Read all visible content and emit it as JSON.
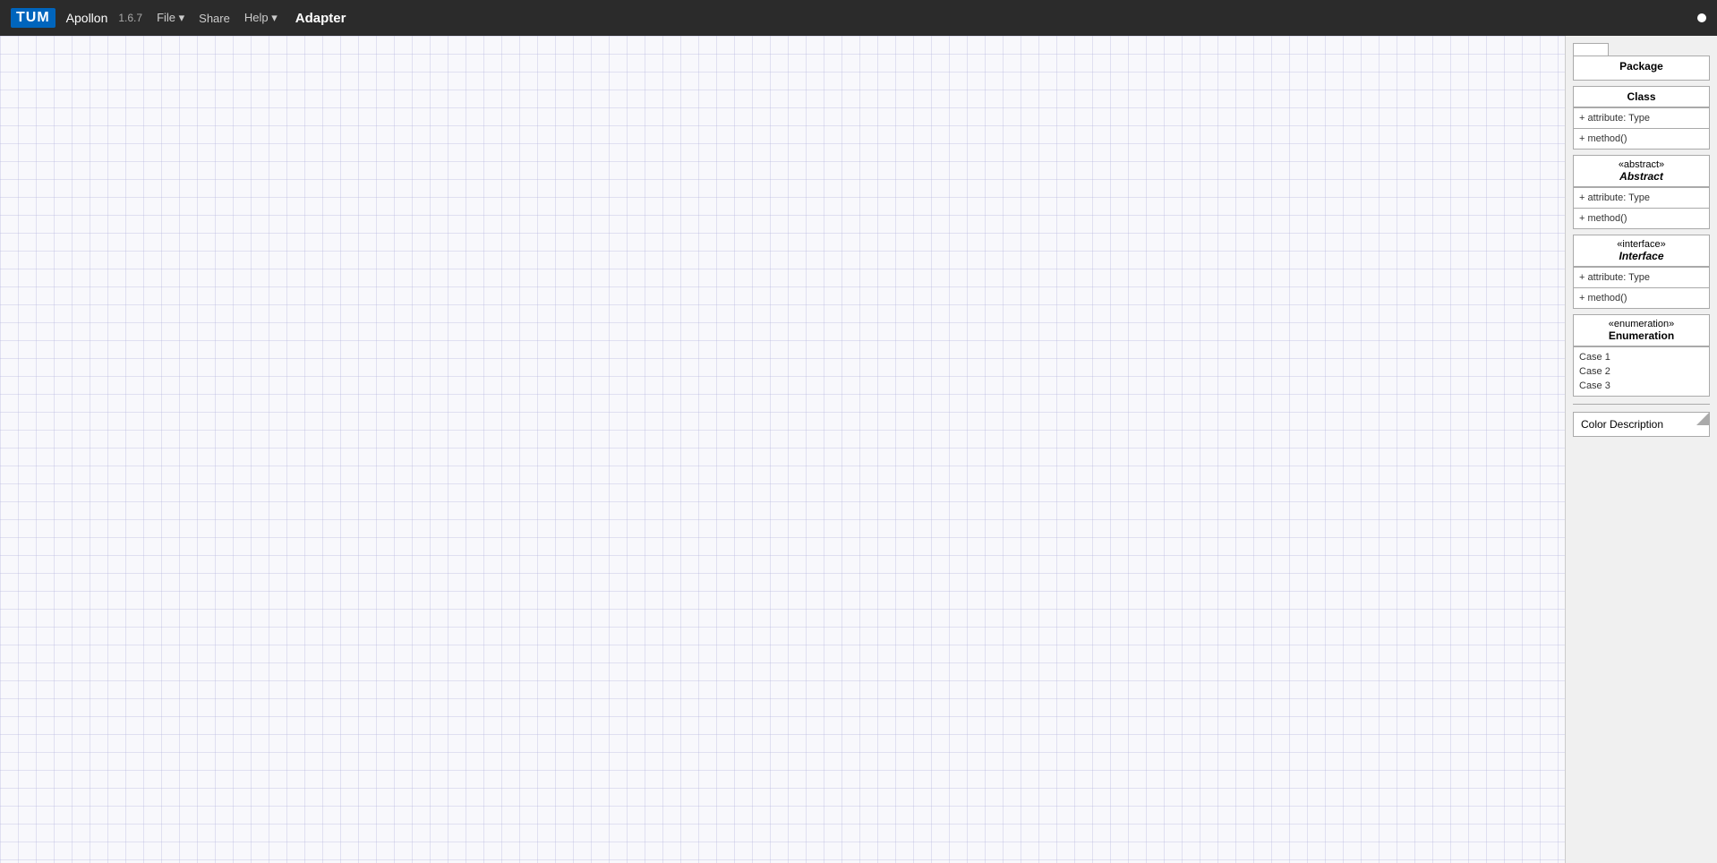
{
  "navbar": {
    "logo": "TUM",
    "app_name": "Apollon",
    "app_version": "1.6.7",
    "menu_items": [
      "File",
      "Share",
      "Help"
    ],
    "diagram_title": "Adapter",
    "status_dot": "white"
  },
  "sidebar": {
    "package": {
      "label": "Package"
    },
    "class": {
      "title": "Class",
      "attribute": "+ attribute: Type",
      "method": "+ method()"
    },
    "abstract": {
      "stereotype": "«abstract»",
      "title": "Abstract",
      "attribute": "+ attribute: Type",
      "method": "+ method()"
    },
    "interface": {
      "stereotype": "«interface»",
      "title": "Interface",
      "attribute": "+ attribute: Type",
      "method": "+ method()"
    },
    "enumeration": {
      "stereotype": "«enumeration»",
      "title": "Enumeration",
      "case1": "Case 1",
      "case2": "Case 2",
      "case3": "Case 3"
    },
    "color_description": {
      "label": "Color Description"
    }
  }
}
